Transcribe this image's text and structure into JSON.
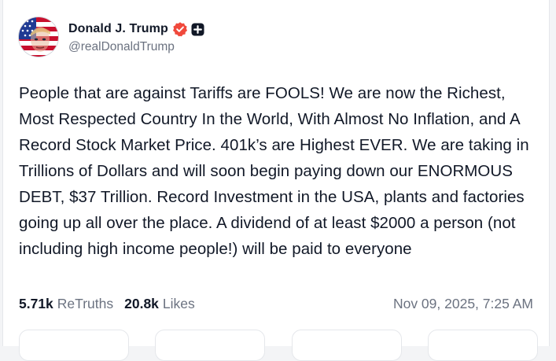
{
  "post": {
    "author": {
      "display_name": "Donald J. Trump",
      "handle": "@realDonaldTrump",
      "verified_icon": "verified-badge-icon",
      "plus_icon": "plus-badge-icon",
      "verified_color": "#f0493c"
    },
    "text": "People that are against Tariffs are FOOLS! We are now the Richest, Most Respected Country In the World, With Almost No Inflation, and A Record Stock Market Price. 401k’s are Highest EVER. We are taking in Trillions of Dollars and will soon begin paying down our ENORMOUS DEBT, $37 Trillion. Record Investment in the USA, plants and factories going up all over the place. A dividend of at least $2000 a person (not including high income people!) will be paid to everyone",
    "stats": {
      "retruths_count": "5.71k",
      "retruths_label": "ReTruths",
      "likes_count": "20.8k",
      "likes_label": "Likes"
    },
    "timestamp": "Nov 09, 2025, 7:25 AM"
  }
}
